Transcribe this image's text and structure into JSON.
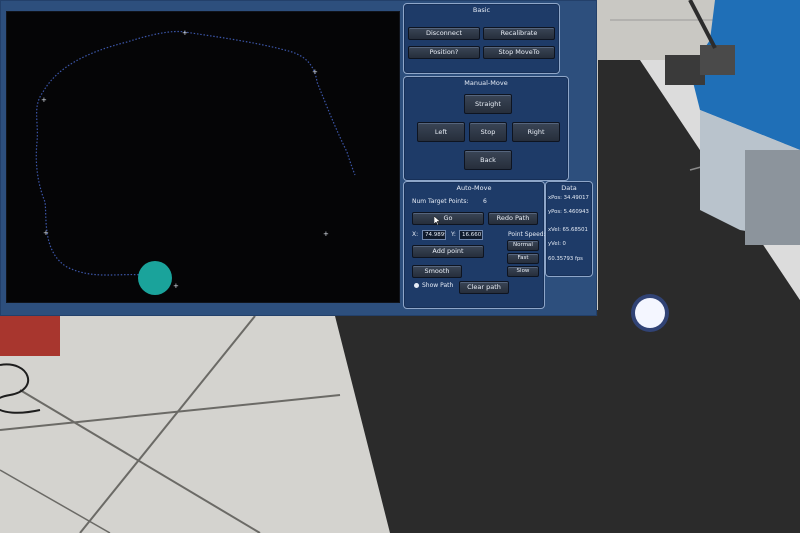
{
  "basic": {
    "title": "Basic",
    "disconnect": "Disconnect",
    "recalibrate": "Recalibrate",
    "position": "Position?",
    "stop_moveto": "Stop MoveTo"
  },
  "manual": {
    "title": "Manual-Move",
    "straight": "Straight",
    "left": "Left",
    "stop": "Stop",
    "right": "Right",
    "back": "Back"
  },
  "auto": {
    "title": "Auto-Move",
    "num_target_label": "Num Target Points:",
    "num_target_value": "6",
    "go": "Go",
    "redo_path": "Redo Path",
    "x_label": "X:",
    "x_value": "74.9899",
    "y_label": "Y:",
    "y_value": "16.6601",
    "point_speed_label": "Point Speed:",
    "normal": "Normal",
    "fast": "Fast",
    "slow": "Slow",
    "add_point": "Add point",
    "smooth": "Smooth",
    "show_path": "Show Path",
    "clear_path": "Clear path"
  },
  "data_panel": {
    "title": "Data",
    "xpos": "xPos: 34.49017",
    "ypos": "yPos: 5.460943",
    "xvel": "xVel: 65.68501",
    "yvel": "yVel: 0",
    "fps": "60.35793 fps"
  },
  "colors": {
    "app_bg": "#2d4f7d",
    "panel_bg": "#1e3b68",
    "canvas_bg": "#050506",
    "robot": "#1aa39b",
    "path": "#3c56a8"
  }
}
